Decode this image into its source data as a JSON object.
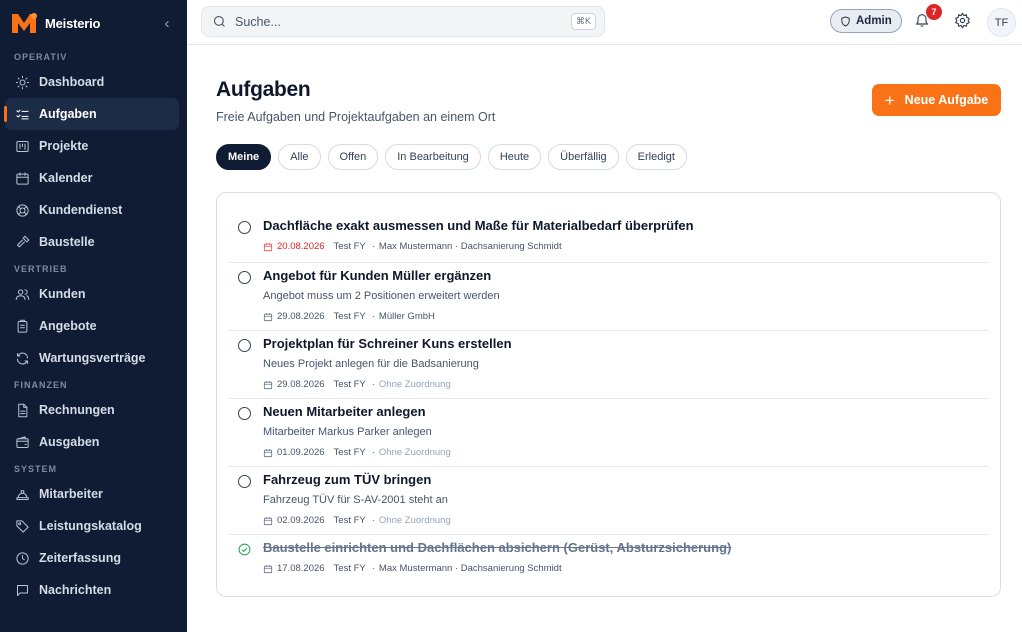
{
  "app": {
    "name": "Meisterio",
    "collapse_icon": "‹"
  },
  "sidebar": {
    "sections": [
      {
        "title": "OPERATIV",
        "items": [
          {
            "label": "Dashboard",
            "icon": "sun-icon"
          },
          {
            "label": "Aufgaben",
            "icon": "list-check-icon",
            "active": true
          },
          {
            "label": "Projekte",
            "icon": "kanban-icon"
          },
          {
            "label": "Kalender",
            "icon": "calendar-icon"
          },
          {
            "label": "Kundendienst",
            "icon": "lifebuoy-icon"
          },
          {
            "label": "Baustelle",
            "icon": "hammer-icon"
          }
        ]
      },
      {
        "title": "VERTRIEB",
        "items": [
          {
            "label": "Kunden",
            "icon": "users-icon"
          },
          {
            "label": "Angebote",
            "icon": "clipboard-icon"
          },
          {
            "label": "Wartungsverträge",
            "icon": "refresh-icon"
          }
        ]
      },
      {
        "title": "FINANZEN",
        "items": [
          {
            "label": "Rechnungen",
            "icon": "file-icon"
          },
          {
            "label": "Ausgaben",
            "icon": "wallet-icon"
          }
        ]
      },
      {
        "title": "SYSTEM",
        "items": [
          {
            "label": "Mitarbeiter",
            "icon": "hardhat-icon"
          },
          {
            "label": "Leistungskatalog",
            "icon": "tag-icon"
          },
          {
            "label": "Zeiterfassung",
            "icon": "clock-icon"
          },
          {
            "label": "Nachrichten",
            "icon": "message-icon"
          }
        ]
      }
    ]
  },
  "topbar": {
    "search_placeholder": "Suche...",
    "shortcut": "⌘K",
    "role_label": "Admin",
    "notification_count": "7",
    "avatar_initials": "TF"
  },
  "main": {
    "title": "Aufgaben",
    "subtitle": "Freie Aufgaben und Projektaufgaben an einem Ort",
    "new_button_label": "Neue Aufgabe",
    "filters": [
      {
        "label": "Meine",
        "active": true
      },
      {
        "label": "Alle"
      },
      {
        "label": "Offen"
      },
      {
        "label": "In Bearbeitung"
      },
      {
        "label": "Heute"
      },
      {
        "label": "Überfällig"
      },
      {
        "label": "Erledigt"
      }
    ],
    "tasks": [
      {
        "title": "Dachfläche exakt ausmessen und Maße für Materialbedarf überprüfen",
        "description": "",
        "date": "20.08.2026",
        "overdue": true,
        "owner": "Test FY",
        "assignment": "Max Mustermann · Dachsanierung Schmidt",
        "unassigned": false,
        "done": false
      },
      {
        "title": "Angebot für Kunden Müller ergänzen",
        "description": "Angebot muss um 2 Positionen erweitert werden",
        "date": "29.08.2026",
        "overdue": false,
        "owner": "Test FY",
        "assignment": "Müller GmbH",
        "unassigned": false,
        "done": false
      },
      {
        "title": "Projektplan für Schreiner Kuns erstellen",
        "description": "Neues Projekt anlegen für die Badsanierung",
        "date": "29.08.2026",
        "overdue": false,
        "owner": "Test FY",
        "assignment": "Ohne Zuordnung",
        "unassigned": true,
        "done": false
      },
      {
        "title": "Neuen Mitarbeiter anlegen",
        "description": "Mitarbeiter Markus Parker anlegen",
        "date": "01.09.2026",
        "overdue": false,
        "owner": "Test FY",
        "assignment": "Ohne Zuordnung",
        "unassigned": true,
        "done": false
      },
      {
        "title": "Fahrzeug zum TÜV bringen",
        "description": "Fahrzeug TÜV für S-AV-2001 steht an",
        "date": "02.09.2026",
        "overdue": false,
        "owner": "Test FY",
        "assignment": "Ohne Zuordnung",
        "unassigned": true,
        "done": false
      },
      {
        "title": "Baustelle einrichten und Dachflächen absichern (Gerüst, Absturzsicherung)",
        "description": "",
        "date": "17.08.2026",
        "overdue": false,
        "owner": "Test FY",
        "assignment": "Max Mustermann · Dachsanierung Schmidt",
        "unassigned": false,
        "done": true
      }
    ]
  },
  "colors": {
    "sidebar_bg": "#0f1c33",
    "accent": "#f97316",
    "danger": "#dc2626",
    "success": "#16a34a"
  }
}
